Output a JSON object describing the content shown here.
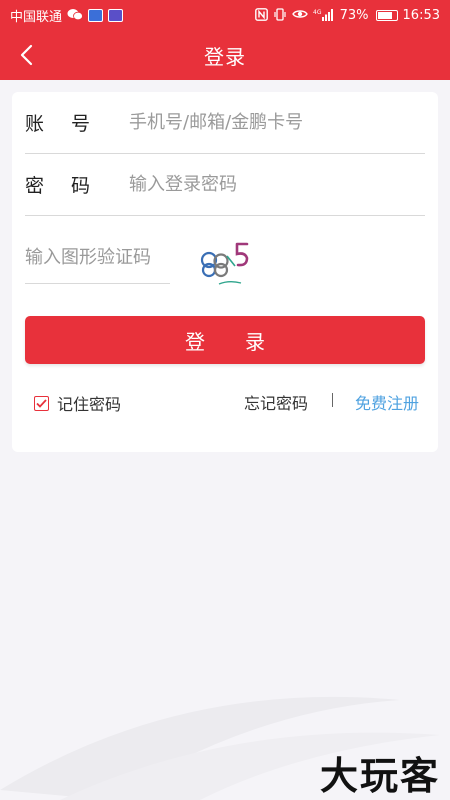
{
  "status_bar": {
    "carrier": "中国联通",
    "battery": "73%",
    "time": "16:53"
  },
  "nav": {
    "title": "登录"
  },
  "form": {
    "account_label_1": "账",
    "account_label_2": "号",
    "account_placeholder": "手机号/邮箱/金鹏卡号",
    "password_label_1": "密",
    "password_label_2": "码",
    "password_placeholder": "输入登录密码",
    "captcha_placeholder": "输入图形验证码"
  },
  "login_button": {
    "char1": "登",
    "char2": "录"
  },
  "options": {
    "remember_label": "记住密码",
    "remember_checked": true,
    "forgot_label": "忘记密码",
    "register_label": "免费注册"
  },
  "watermark": "大玩客",
  "colors": {
    "brand_red": "#e8313b",
    "link_blue": "#4fa2e0"
  }
}
